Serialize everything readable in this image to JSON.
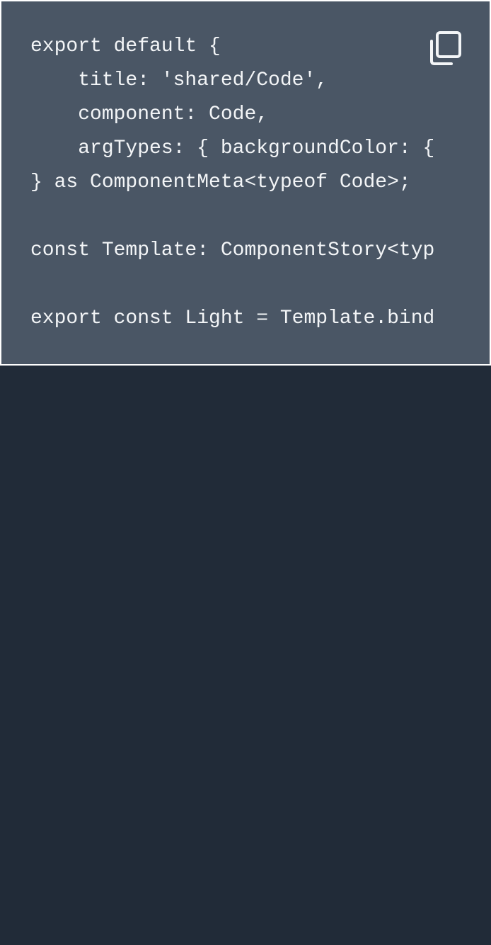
{
  "code_block": {
    "lines": [
      "export default {",
      "    title: 'shared/Code',",
      "    component: Code,",
      "    argTypes: { backgroundColor: {",
      "} as ComponentMeta<typeof Code>;",
      "",
      "const Template: ComponentStory<typ",
      "",
      "export const Light = Template.bind"
    ],
    "copy_icon": "copy-icon"
  },
  "colors": {
    "code_background": "#4a5665",
    "page_background": "#212b38",
    "code_text": "#f3f5f7",
    "border": "#ffffff"
  }
}
